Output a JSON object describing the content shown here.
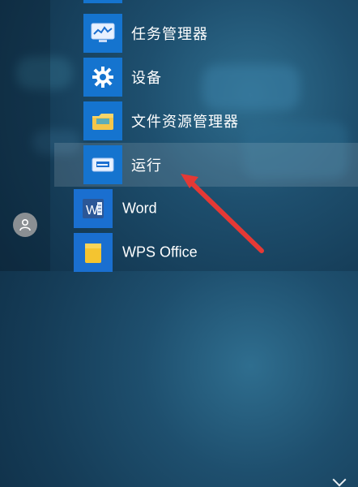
{
  "menu": {
    "items": [
      {
        "label": "任务管理器",
        "icon": "task-manager-icon"
      },
      {
        "label": "设备",
        "icon": "gear-icon"
      },
      {
        "label": "文件资源管理器",
        "icon": "folder-icon"
      },
      {
        "label": "运行",
        "icon": "run-dialog-icon"
      }
    ],
    "apps": [
      {
        "label": "Word",
        "icon": "word-icon",
        "color": "#1a6fd0"
      },
      {
        "label": "WPS Office",
        "icon": "wps-folder-icon",
        "color": "#f4c430"
      }
    ]
  },
  "user": {
    "icon": "user-avatar-icon"
  },
  "colors": {
    "tile_blue": "#1574cf",
    "arrow_red": "#e53935",
    "highlight": "rgba(255,255,255,0.13)"
  }
}
